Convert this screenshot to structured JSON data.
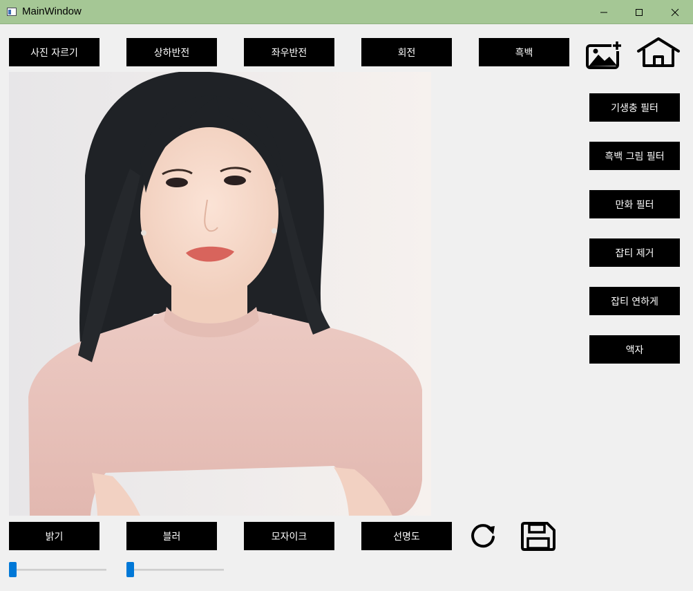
{
  "window": {
    "title": "MainWindow",
    "controls": {
      "minimize": "minimize-icon",
      "maximize": "maximize-icon",
      "close": "close-icon"
    }
  },
  "toolbar_top": {
    "buttons": [
      "사진 자르기",
      "상하반전",
      "좌우반전",
      "회전",
      "흑백"
    ],
    "icons": [
      "add-image-icon",
      "home-icon"
    ]
  },
  "side_filters": {
    "buttons": [
      "기생충 필터",
      "흑백 그림 필터",
      "만화 필터",
      "잡티 제거",
      "잡티 연하게",
      "액자"
    ]
  },
  "toolbar_bottom": {
    "buttons": [
      "밝기",
      "블러",
      "모자이크",
      "선명도"
    ],
    "icons": [
      "refresh-icon",
      "save-icon"
    ]
  },
  "sliders": {
    "brightness_value": 0,
    "blur_value": 0
  },
  "colors": {
    "titlebar": "#a5c795",
    "button_bg": "#000000",
    "button_text": "#ffffff",
    "slider_handle": "#0078d7"
  }
}
